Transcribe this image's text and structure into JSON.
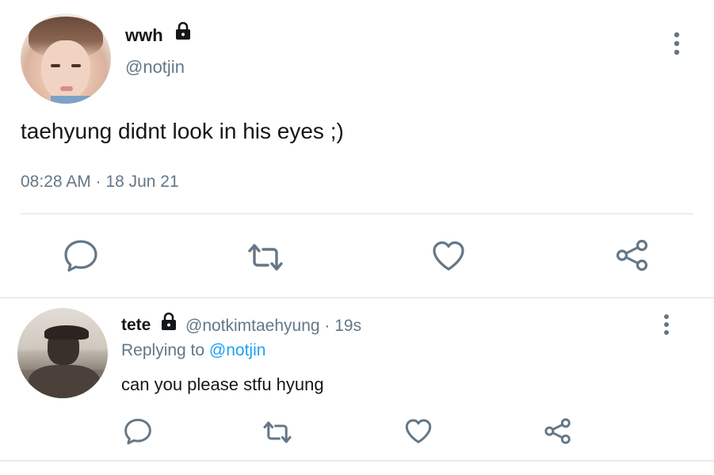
{
  "main_tweet": {
    "display_name": "wwh",
    "handle": "@notjin",
    "text": "taehyung didnt look in his eyes ;)",
    "timestamp": "08:28 AM · 18 Jun 21",
    "protected_icon": "lock-icon"
  },
  "reply_tweet": {
    "display_name": "tete",
    "handle_meta": "@notkimtaehyung · 19s",
    "replying_prefix": "Replying to ",
    "replying_mention": "@notjin",
    "text": "can you please stfu hyung",
    "protected_icon": "lock-icon"
  },
  "actions": {
    "reply": "reply-icon",
    "retweet": "retweet-icon",
    "like": "heart-icon",
    "share": "share-icon",
    "more": "more-vertical-icon"
  },
  "colors": {
    "text_primary": "#14171a",
    "text_secondary": "#657786",
    "link": "#1da1f2",
    "divider": "#e6ecf0",
    "icon": "#657786"
  }
}
